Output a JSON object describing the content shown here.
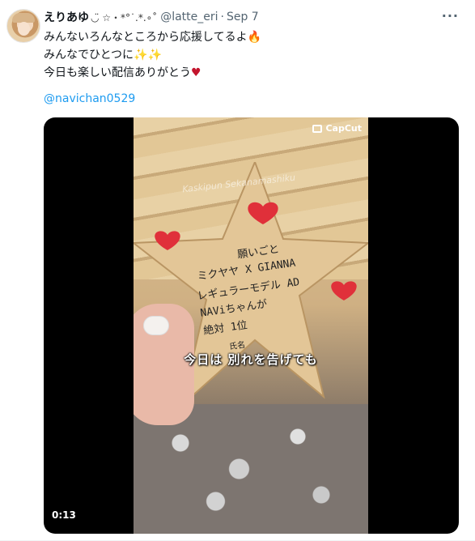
{
  "tweet": {
    "display_name": "えりあゆ",
    "name_decoration": "◡̈ ☆・*°˙.*.∘˚",
    "handle": "@latte_eri",
    "separator": "·",
    "date": "Sep 7",
    "more_label": "···",
    "text_lines": [
      {
        "text": "みんないろんなところから応援してるよ",
        "emoji": "🔥",
        "emoji_name": "fire-emoji"
      },
      {
        "text": "みんなでひとつに",
        "emoji": "✨✨",
        "emoji_name": "sparkles-emoji"
      },
      {
        "text": "今日も楽しい配信ありがとう",
        "emoji": "♥",
        "emoji_name": "red-heart-emoji"
      }
    ],
    "mention": "@navichan0529"
  },
  "video": {
    "brand": "CapCut",
    "watermark": "Kaskipun Sekanamashiku",
    "subtitle": "今日は 別れを告げても",
    "timecode": "0:13",
    "ema_text": [
      "願いごと",
      "ミクヤヤ X GIANNA",
      "レギュラーモデル AD",
      "NAViちゃんが",
      "絶対 1位",
      "氏名"
    ]
  },
  "colors": {
    "link": "#1d9bf0",
    "muted": "#536471",
    "text": "#0f1419"
  }
}
